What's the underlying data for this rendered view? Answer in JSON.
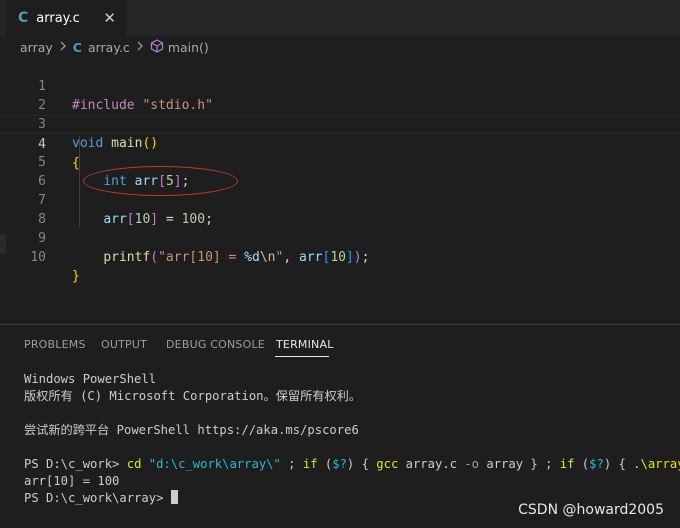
{
  "tab": {
    "icon": "C",
    "label": "array.c",
    "close": "✕"
  },
  "breadcrumb": {
    "folder": "array",
    "file_icon": "C",
    "file": "array.c",
    "symbol": "main()"
  },
  "editor": {
    "line_numbers": [
      "1",
      "2",
      "3",
      "4",
      "5",
      "6",
      "7",
      "8",
      "9",
      "10"
    ],
    "active_line": "4",
    "lines": {
      "l1": {
        "pp": "#include",
        "sp": " ",
        "str": "\"stdio.h\""
      },
      "l3": {
        "kw": "void",
        "sp": " ",
        "fn": "main",
        "open": "(",
        "close": ")"
      },
      "l4": {
        "brace": "{"
      },
      "l5": {
        "indent": "    ",
        "kw": "int",
        "sp": " ",
        "var": "arr",
        "open": "[",
        "num": "5",
        "close": "]",
        "end": ";"
      },
      "l7": {
        "indent": "    ",
        "var": "arr",
        "open": "[",
        "num": "10",
        "close": "]",
        "mid": " = ",
        "num2": "100",
        "end": ";"
      },
      "l9": {
        "indent": "    ",
        "fn": "printf",
        "open": "(",
        "str1": "\"arr[10] = ",
        "fmt": "%d",
        "esc": "\\n",
        "str2": "\"",
        "comma": ", ",
        "var": "arr",
        "bopen": "[",
        "num": "10",
        "bclose": "]",
        "close": ")",
        "end": ";"
      },
      "l10": {
        "brace": "}"
      }
    }
  },
  "panel": {
    "tabs": [
      "PROBLEMS",
      "OUTPUT",
      "DEBUG CONSOLE",
      "TERMINAL"
    ],
    "active_tab": "TERMINAL"
  },
  "terminal": {
    "line1": "Windows PowerShell",
    "line2": "版权所有 (C) Microsoft Corporation。保留所有权利。",
    "line3": "尝试新的跨平台 PowerShell https://aka.ms/pscore6",
    "prompt1": "PS D:\\c_work> ",
    "cmd": {
      "cd": "cd",
      "path": " \"d:\\c_work\\array\\\"",
      "p1": " ; ",
      "if1": "if",
      "p2": " (",
      "var1": "$?",
      "p3": ") { ",
      "gcc": "gcc",
      "args": " array.c ",
      "flag": "-o",
      "out": " array } ; ",
      "if2": "if",
      "p4": " (",
      "var2": "$?",
      "p5": ") { ",
      "exe": ".\\array",
      "p6": " }"
    },
    "output": "arr[10] = 100",
    "prompt2": "PS D:\\c_work\\array> "
  },
  "watermark": "CSDN @howard2005",
  "colors": {
    "annotation": "#c0392b",
    "c_icon": "#519aba"
  }
}
